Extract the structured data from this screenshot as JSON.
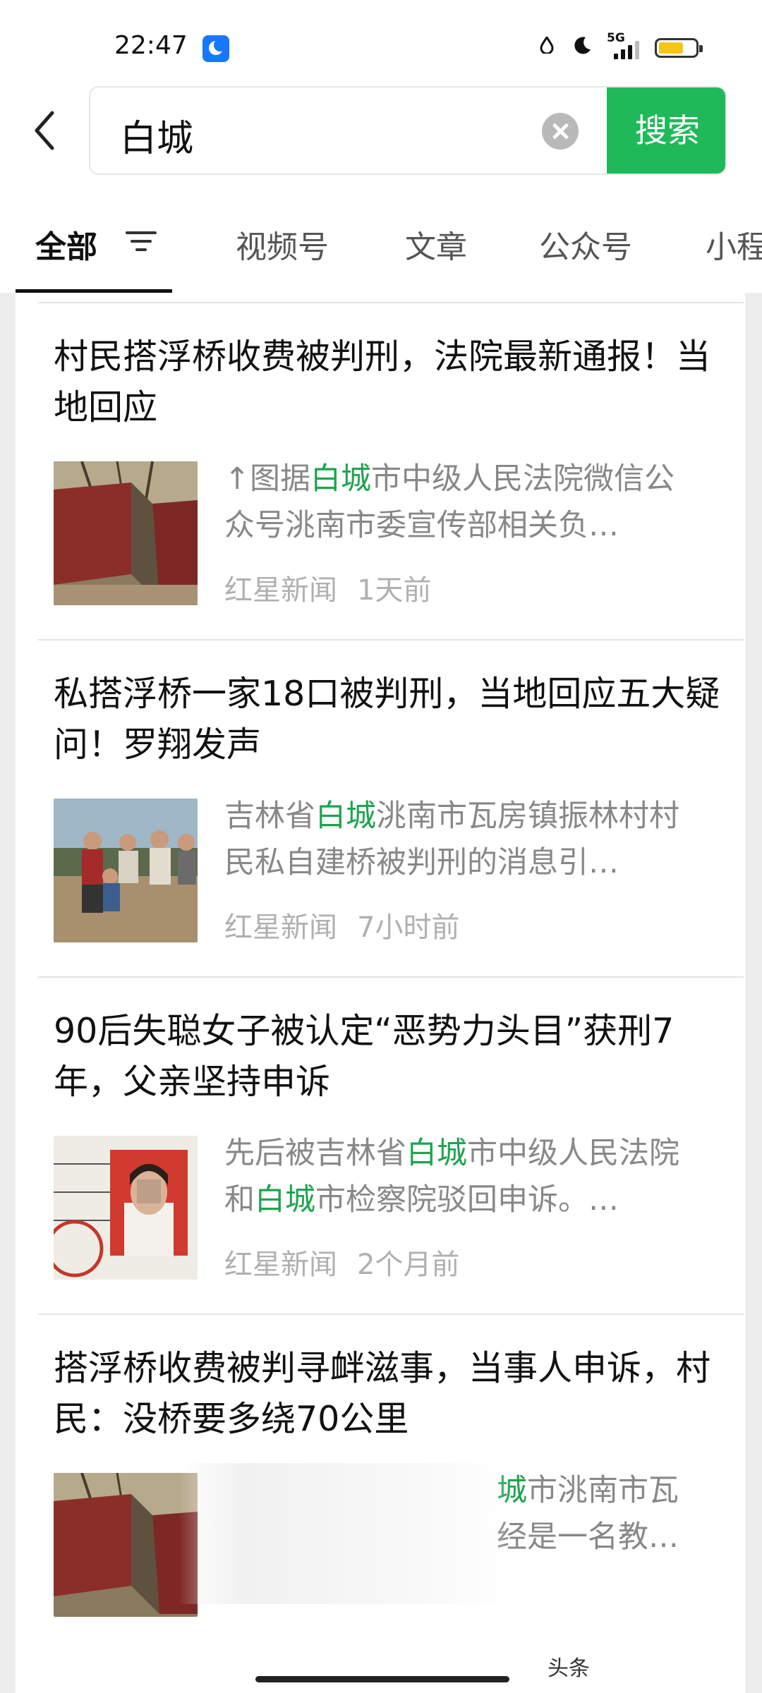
{
  "status": {
    "time": "22:47",
    "network": "5G"
  },
  "search": {
    "query": "白城",
    "button": "搜索"
  },
  "tabs": [
    "全部",
    "视频号",
    "文章",
    "公众号",
    "小程"
  ],
  "results": [
    {
      "title": "村民搭浮桥收费被判刑，法院最新通报！当地回应",
      "snippet_pre": "↑图据",
      "snippet_hl": "白城",
      "snippet_post": "市中级人民法院微信公众号洮南市委宣传部相关负…",
      "source": "红星新闻",
      "time": "1天前"
    },
    {
      "title": "私搭浮桥一家18口被判刑，当地回应五大疑问！罗翔发声",
      "snippet_pre": "吉林省",
      "snippet_hl": "白城",
      "snippet_post": "洮南市瓦房镇振林村村民私自建桥被判刑的消息引…",
      "source": "红星新闻",
      "time": "7小时前"
    },
    {
      "title": "90后失聪女子被认定“恶势力头目”获刑7年，父亲坚持申诉",
      "snippet_pre": "先后被吉林省",
      "snippet_hl": "白城",
      "snippet_mid": "市中级人民法院和",
      "snippet_hl2": "白城",
      "snippet_post": "市检察院驳回申诉。…",
      "source": "红星新闻",
      "time": "2个月前"
    },
    {
      "title": "搭浮桥收费被判寻衅滋事，当事人申诉，村民：没桥要多绕70公里",
      "snippet_hl": "城",
      "snippet_post": "市洮南市瓦",
      "snippet_line2": "经是一名教…"
    }
  ],
  "watermark": "头条"
}
